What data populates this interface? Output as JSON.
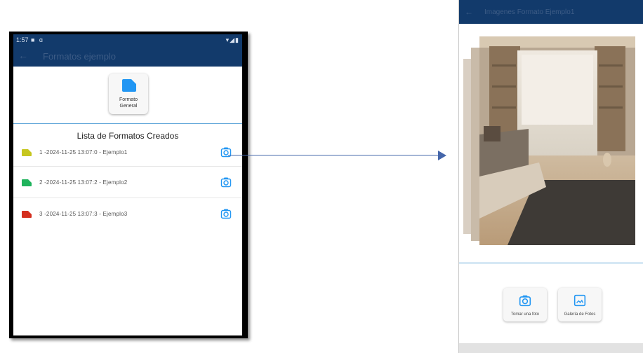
{
  "left_screen": {
    "status": {
      "time": "1:57",
      "icons_left": "■ ɑ",
      "icons_right": "▾◢▮"
    },
    "appbar": {
      "back": "←",
      "title": "Formatos ejemplo"
    },
    "format_card": {
      "label_line1": "Formato",
      "label_line2": "General"
    },
    "list_title": "Lista de Formatos Creados",
    "rows": [
      {
        "text": "1 -2024-11-25 13:07:0 - Ejemplo1",
        "color": "#c6c61f"
      },
      {
        "text": "2 -2024-11-25 13:07:2 - Ejemplo2",
        "color": "#1fb35c"
      },
      {
        "text": "3 -2024-11-25 13:07:3 - Ejemplo3",
        "color": "#d42f1f"
      }
    ]
  },
  "right_screen": {
    "appbar": {
      "back": "←",
      "title": "Imagenes Formato Ejemplo1"
    },
    "buttons": {
      "take_photo": "Tomar una foto",
      "gallery": "Galería de Fotos"
    }
  },
  "colors": {
    "appbar": "#123a6b",
    "accent": "#2196f3",
    "divider": "#5da5d8",
    "arrow": "#4466aa"
  }
}
